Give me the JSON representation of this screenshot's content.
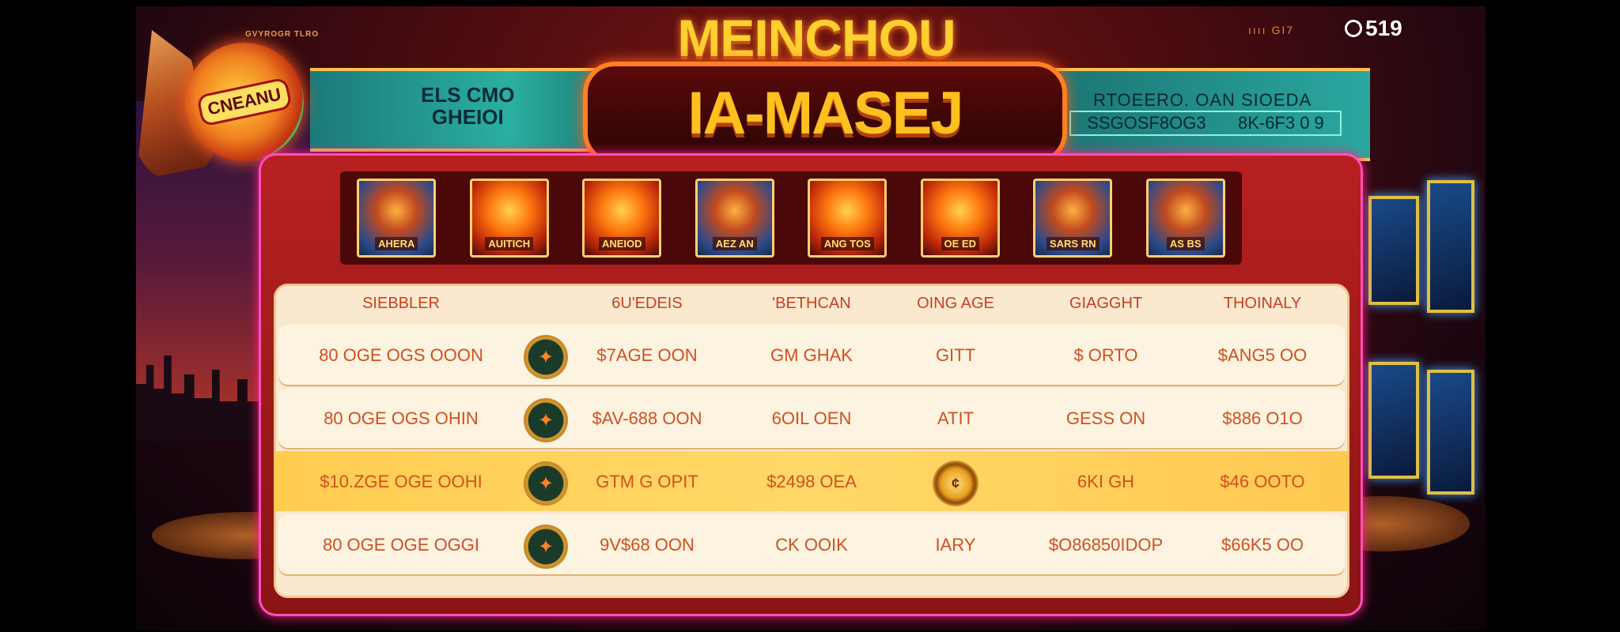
{
  "header": {
    "brand_small": "GVYROGR TLRO",
    "title": "MEINCHOU",
    "plaque": "IA-MASEJ",
    "mini_text": "ıııı  GI7",
    "credits": "519",
    "logo_text": "CNEANU"
  },
  "banner_left": {
    "line1": "ELS CMO",
    "line2": "GHEIOI"
  },
  "banner_right": {
    "line1": "RTOEERO. OAN SIOEDA",
    "value_a": "SSGOSF8OG3",
    "value_b": "8K-6F3 0 9"
  },
  "games": [
    {
      "label": "AHERA",
      "style": "blue"
    },
    {
      "label": "AUITICH",
      "style": "fire"
    },
    {
      "label": "ANEIOD",
      "style": "fire"
    },
    {
      "label": "AEZ AN",
      "style": "blue"
    },
    {
      "label": "ANG TOS",
      "style": "fire"
    },
    {
      "label": "OE ED",
      "style": "fire"
    },
    {
      "label": "SARS RN",
      "style": "blue"
    },
    {
      "label": "AS BS",
      "style": "blue"
    }
  ],
  "table": {
    "headers": [
      "SIEBBLER",
      "6U'EDEIS",
      "'BETHCAN",
      "OING AGE",
      "GIAGGHT",
      "THOINALY"
    ],
    "rows": [
      {
        "c1": "80 OGE OGS OOON",
        "c2": "$7AGE OON",
        "c3": "GM GHAK",
        "c4": "GITT",
        "c5": "$ ORTO",
        "c6": "$ANG5 OO",
        "highlight": false
      },
      {
        "c1": "80 OGE OGS OHIN",
        "c2": "$AV-688 OON",
        "c3": "6OIL OEN",
        "c4": "ATIT",
        "c5": "GESS ON",
        "c6": "$886 O1O",
        "highlight": false
      },
      {
        "c1": "$10.ZGE OGE OOHI",
        "c2": "GTM G OPIT",
        "c3": "$2498 OEA",
        "c4": "",
        "c5": "6KI GH",
        "c6": "$46 OOTO",
        "highlight": true
      },
      {
        "c1": "80 OGE OGE OGGI",
        "c2": "9V$68 OON",
        "c3": "CK OOIK",
        "c4": "IARY",
        "c5": "$O86850IDOP",
        "c6": "$66K5 OO",
        "highlight": false
      }
    ]
  },
  "colors": {
    "accent": "#ffd030",
    "board": "#b82020",
    "table_bg": "#fbe9cf",
    "highlight": "#ffcc50",
    "text": "#d05020"
  }
}
